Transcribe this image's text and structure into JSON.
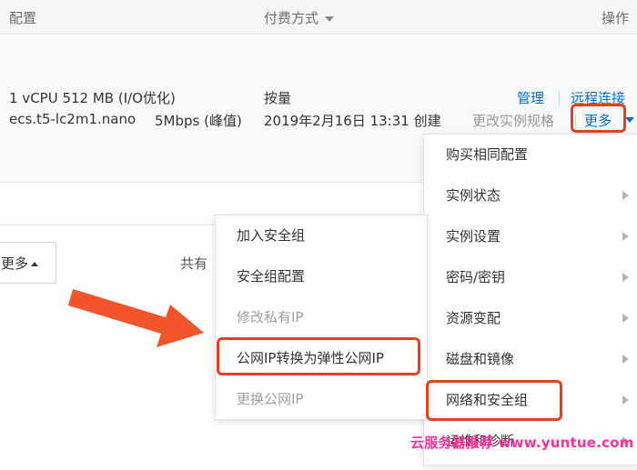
{
  "table_header": {
    "config": "配置",
    "billing": "付费方式",
    "actions": "操作"
  },
  "instance_row": {
    "spec_line1": "1 vCPU 512 MB (I/O优化)",
    "spec_line2_type": "ecs.t5-lc2m1.nano",
    "spec_line2_bandwidth": "5Mbps (峰值)",
    "billing_type": "按量",
    "created_time": "2019年2月16日 13:31 创建",
    "manage": "管理",
    "remote_connect": "远程连接",
    "change_spec": "更改实例规格",
    "more": "更多"
  },
  "bottom_bar": {
    "more_button": "更多",
    "total_prefix": "共有"
  },
  "more_menu": {
    "items": [
      {
        "label": "购买相同配置",
        "submenu": false
      },
      {
        "label": "实例状态",
        "submenu": true
      },
      {
        "label": "实例设置",
        "submenu": true
      },
      {
        "label": "密码/密钥",
        "submenu": true
      },
      {
        "label": "资源变配",
        "submenu": true
      },
      {
        "label": "磁盘和镜像",
        "submenu": true
      },
      {
        "label": "网络和安全组",
        "submenu": true
      },
      {
        "label": "运维和诊断",
        "submenu": true
      }
    ]
  },
  "network_submenu": {
    "items": [
      {
        "label": "加入安全组",
        "disabled": false
      },
      {
        "label": "安全组配置",
        "disabled": false
      },
      {
        "label": "修改私有IP",
        "disabled": true
      },
      {
        "label": "公网IP转换为弹性公网IP",
        "disabled": false
      },
      {
        "label": "更换公网IP",
        "disabled": true
      }
    ]
  },
  "watermark": "云服务器推荐 www.yuntue.com",
  "colors": {
    "link": "#0070cc",
    "highlight": "#e8401c",
    "watermark": "#ff2f9a",
    "disabled_text": "#a0a0a0"
  }
}
